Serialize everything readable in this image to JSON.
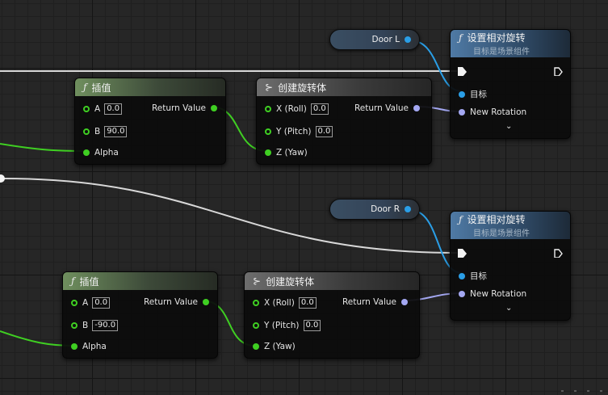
{
  "canvas": {
    "name": "blueprint-event-graph"
  },
  "getters": [
    {
      "label": "Door L"
    },
    {
      "label": "Door R"
    }
  ],
  "lerp_nodes": [
    {
      "title": "插值",
      "a_label": "A",
      "a_value": "0.0",
      "b_label": "B",
      "b_value": "90.0",
      "alpha_label": "Alpha",
      "output_label": "Return Value"
    },
    {
      "title": "插值",
      "a_label": "A",
      "a_value": "0.0",
      "b_label": "B",
      "b_value": "-90.0",
      "alpha_label": "Alpha",
      "output_label": "Return Value"
    }
  ],
  "rotator_nodes": [
    {
      "title": "创建旋转体",
      "roll_label": "X (Roll)",
      "roll_value": "0.0",
      "pitch_label": "Y (Pitch)",
      "pitch_value": "0.0",
      "yaw_label": "Z (Yaw)",
      "output_label": "Return Value"
    },
    {
      "title": "创建旋转体",
      "roll_label": "X (Roll)",
      "roll_value": "0.0",
      "pitch_label": "Y (Pitch)",
      "pitch_value": "0.0",
      "yaw_label": "Z (Yaw)",
      "output_label": "Return Value"
    }
  ],
  "set_rotation_nodes": [
    {
      "title": "设置相对旋转",
      "subtitle": "目标是场景组件",
      "target_label": "目标",
      "rotation_label": "New Rotation"
    },
    {
      "title": "设置相对旋转",
      "subtitle": "目标是场景组件",
      "target_label": "目标",
      "rotation_label": "New Rotation"
    }
  ],
  "icons": {
    "function": "ƒ",
    "make": "⊱",
    "expand": "⌄"
  },
  "colors": {
    "float_pin": "#3fcf22",
    "object_pin": "#2a9ee6",
    "struct_pin": "#a4a8f2",
    "exec_wire": "#d8d8d8"
  }
}
